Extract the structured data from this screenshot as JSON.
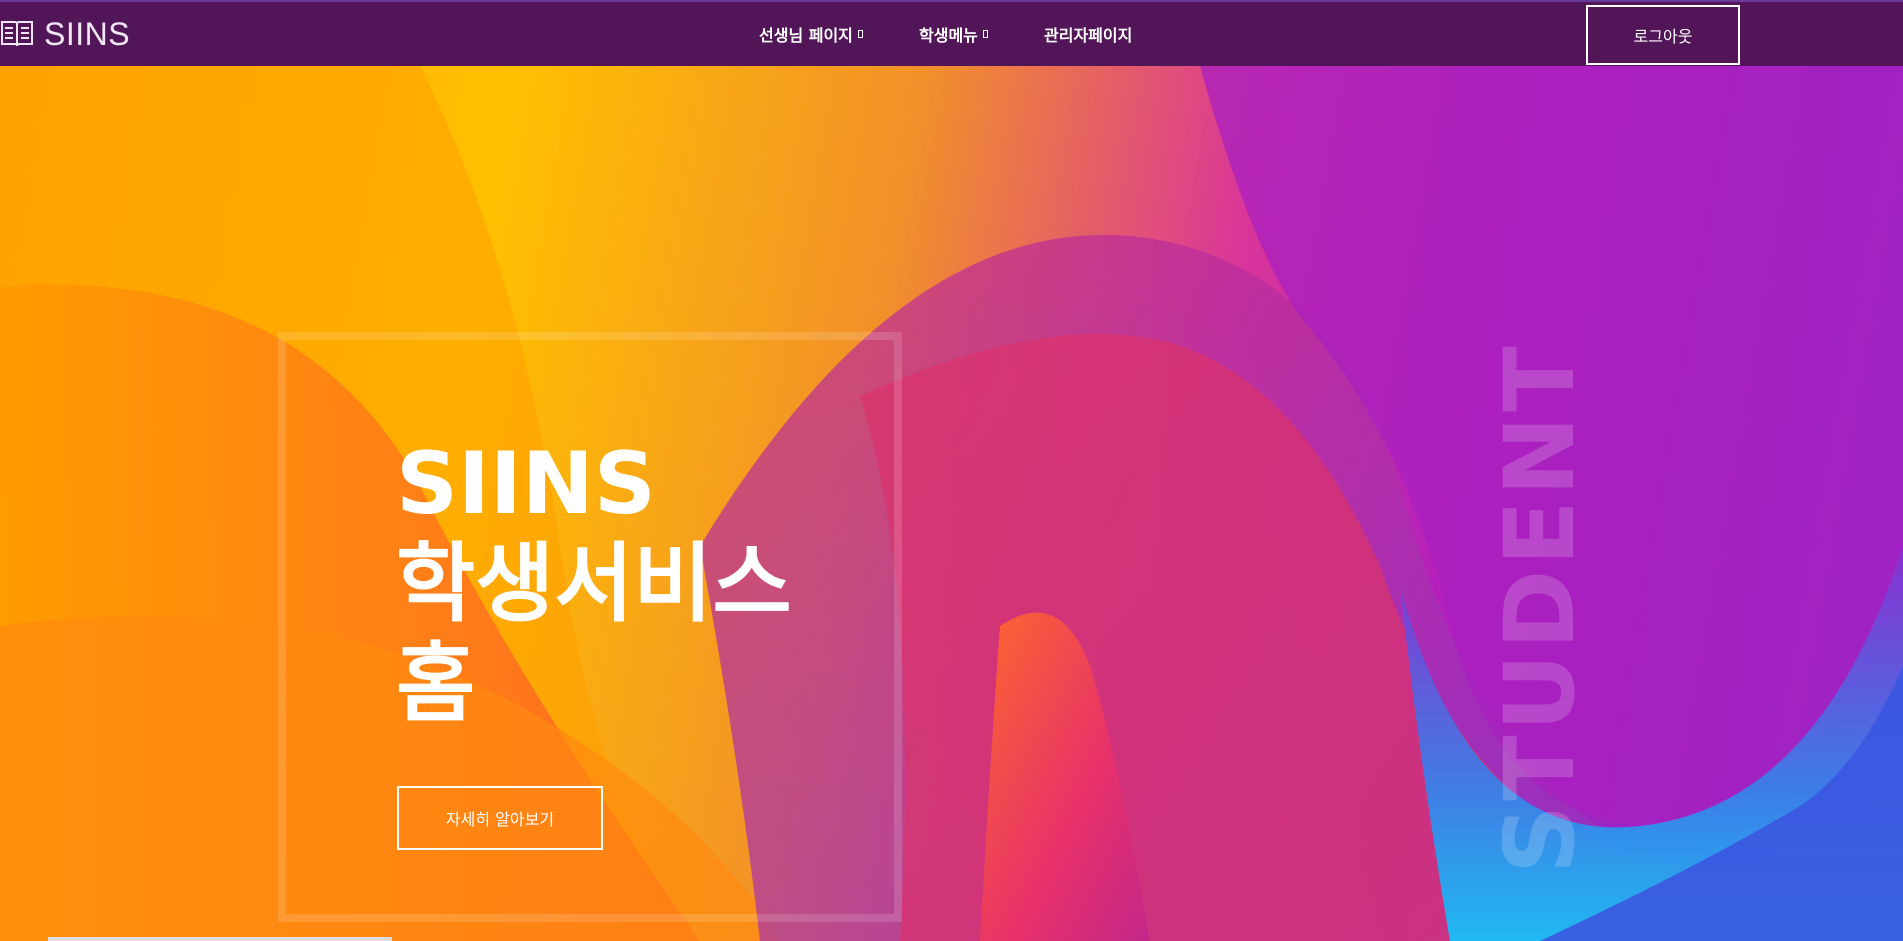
{
  "header": {
    "logo_text": "SIINS",
    "logo_icon": "book-icon",
    "nav": [
      {
        "label": "선생님 페이지",
        "has_dropdown": true
      },
      {
        "label": "학생메뉴",
        "has_dropdown": true
      },
      {
        "label": "관리자페이지",
        "has_dropdown": false
      }
    ],
    "logout_label": "로그아웃"
  },
  "hero": {
    "title_line1": "SIINS",
    "title_line2": "학생서비스",
    "title_line3": "홈",
    "cta_label": "자세히 알아보기",
    "side_word": "STUDENT"
  },
  "colors": {
    "topbar": "#521558",
    "orange": "#ffa500",
    "yellow": "#ffc000",
    "magenta": "#b31fbd",
    "blue": "#1db7f5",
    "pink": "#e8306a"
  }
}
